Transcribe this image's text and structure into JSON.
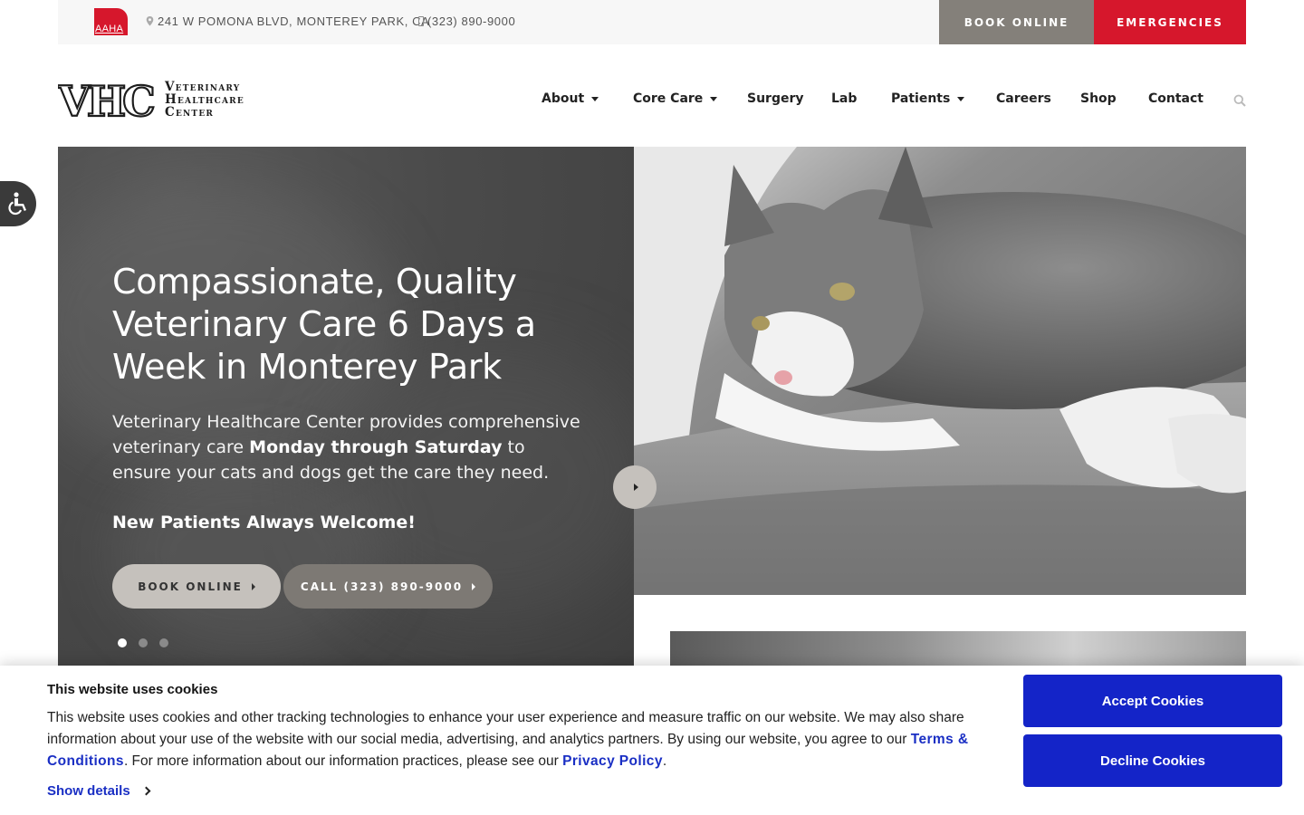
{
  "topbar": {
    "aaha_label": "AAHA",
    "address": "241 W POMONA BLVD, MONTEREY PARK, CA",
    "phone": "(323) 890-9000",
    "book_online": "BOOK ONLINE",
    "emergencies": "EMERGENCIES"
  },
  "logo": {
    "mark": "VHC",
    "line1": "Veterinary",
    "line2": "Healthcare",
    "line3": "Center"
  },
  "nav": {
    "items": [
      {
        "label": "About",
        "dropdown": true
      },
      {
        "label": "Core Care",
        "dropdown": true
      },
      {
        "label": "Surgery",
        "dropdown": false
      },
      {
        "label": "Lab",
        "dropdown": false
      },
      {
        "label": "Patients",
        "dropdown": true
      },
      {
        "label": "Careers",
        "dropdown": false
      },
      {
        "label": "Shop",
        "dropdown": false
      },
      {
        "label": "Contact",
        "dropdown": false
      }
    ],
    "search_icon": "search-icon"
  },
  "hero": {
    "title": "Compassionate, Quality Veterinary Care 6 Days a Week in Monterey Park",
    "desc_before": "Veterinary Healthcare Center provides comprehensive veterinary care ",
    "desc_bold": "Monday through Saturday",
    "desc_after": " to ensure your cats and dogs get the care they need.",
    "welcome": "New Patients Always Welcome!",
    "book_button": "BOOK ONLINE",
    "call_button": "CALL (323) 890-9000",
    "slides_count": 3,
    "active_slide": 1
  },
  "cookie": {
    "title": "This website uses cookies",
    "text_1": "This website uses cookies and other tracking technologies to enhance your user experience and measure traffic on our website. We may also share information about your use of the website with our social media, advertising, and analytics partners. By using our website, you agree to our ",
    "terms_link": "Terms & Conditions",
    "text_2": ". For more information about our information practices, please see our ",
    "privacy_link": "Privacy Policy",
    "text_3": ".",
    "show_details": "Show details",
    "accept": "Accept Cookies",
    "decline": "Decline Cookies"
  },
  "colors": {
    "brand_red": "#d6172c",
    "gray_button": "#84807a",
    "cookie_blue": "#1424c8"
  }
}
